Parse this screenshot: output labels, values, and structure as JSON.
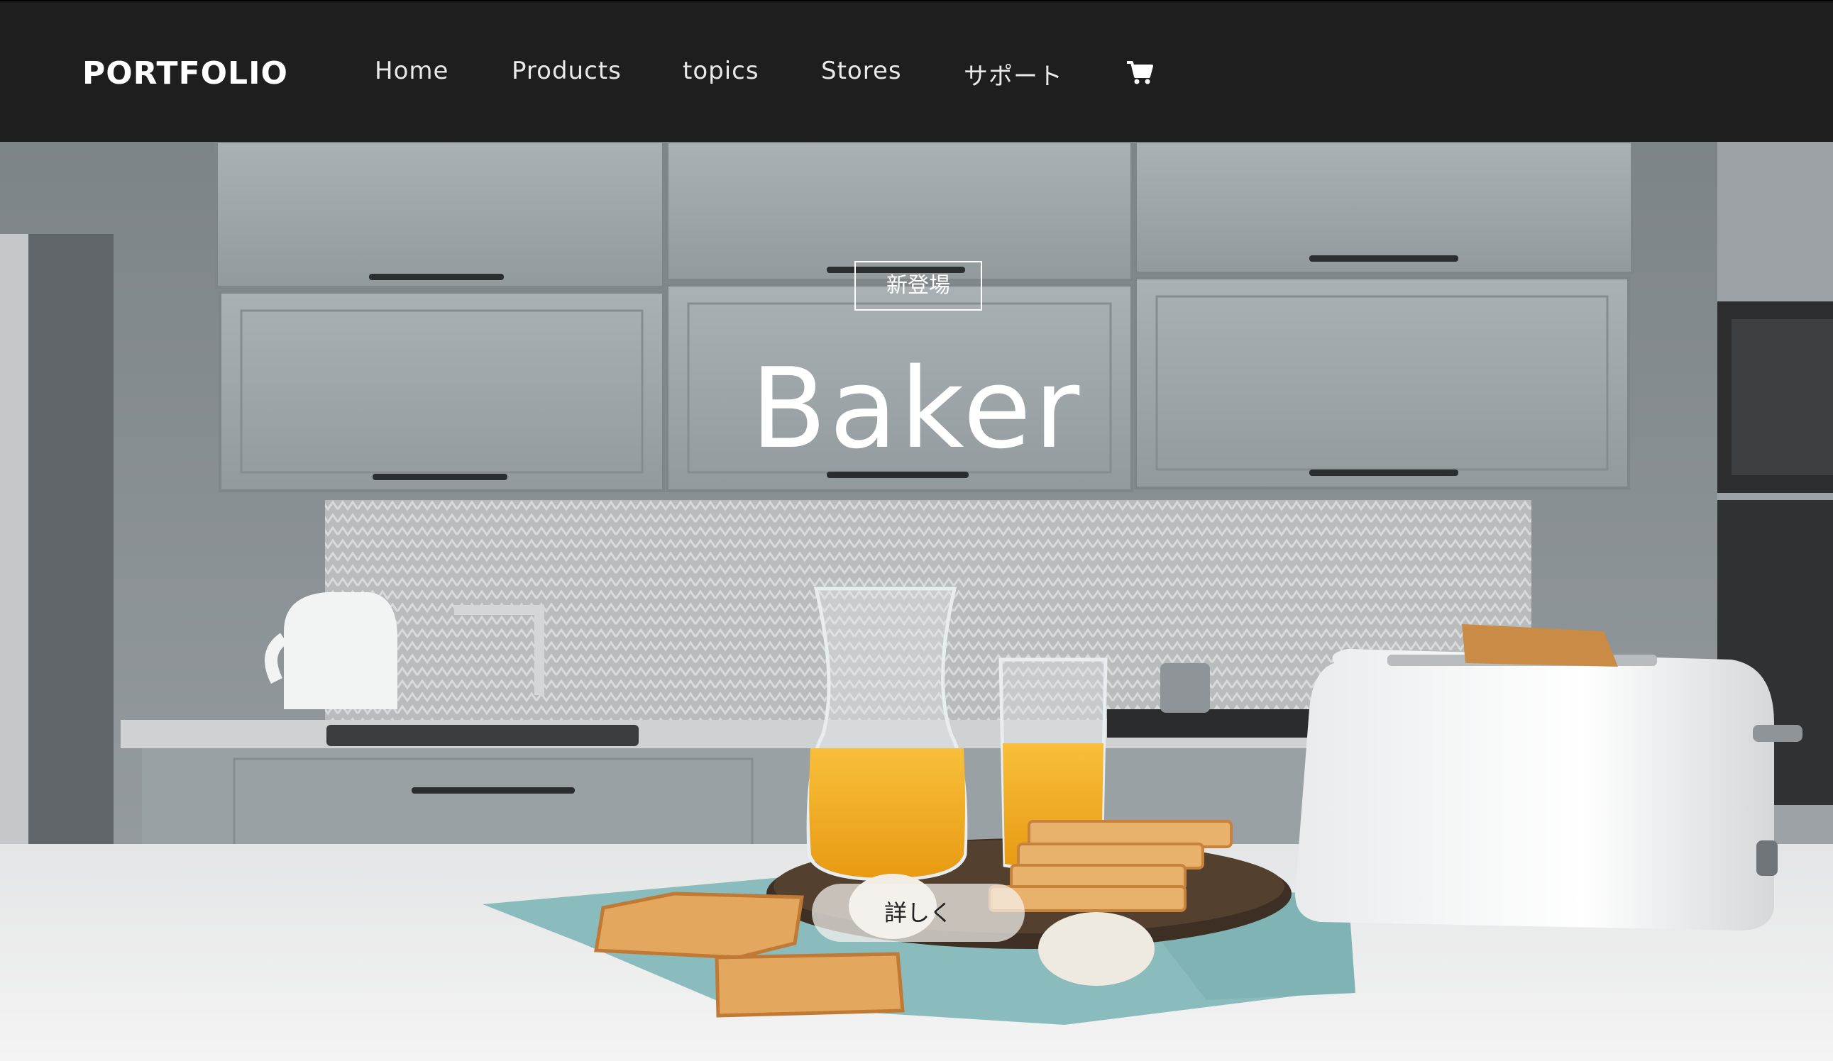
{
  "header": {
    "logo": "PORTFOLIO",
    "nav": [
      "Home",
      "Products",
      "topics",
      "Stores",
      "サポート"
    ],
    "cart_icon": "cart-icon"
  },
  "hero": {
    "badge": "新登場",
    "title": "Baker",
    "button_label": "詳しく"
  },
  "colors": {
    "header_bg": "#1e1e1e",
    "text_light": "#ffffff"
  }
}
